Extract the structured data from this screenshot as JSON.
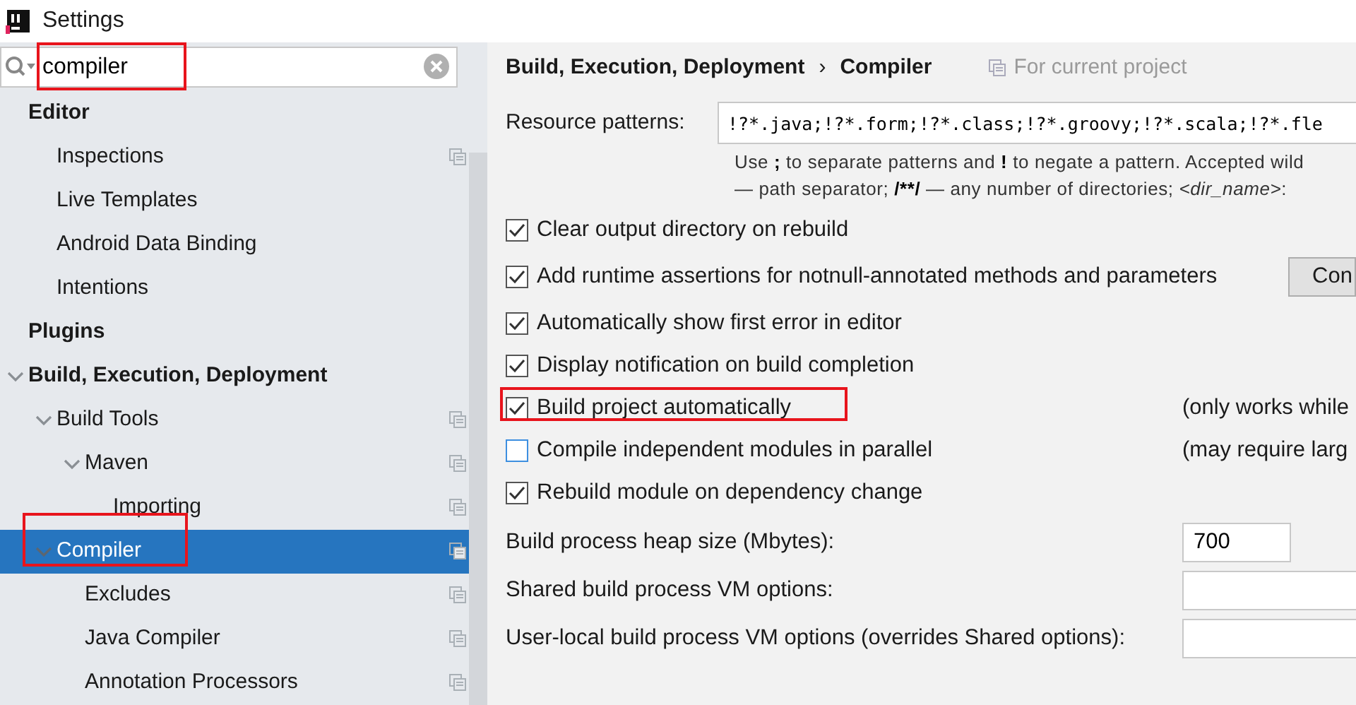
{
  "window": {
    "title": "Settings"
  },
  "search": {
    "value": "compiler",
    "annotated": true
  },
  "tree": [
    {
      "label": "Editor",
      "bold": true,
      "children": [
        {
          "label": "Inspections",
          "project_level": true
        },
        {
          "label": "Live Templates",
          "project_level": false
        },
        {
          "label": "Android Data Binding",
          "project_level": false
        },
        {
          "label": "Intentions",
          "project_level": false
        }
      ]
    },
    {
      "label": "Plugins",
      "bold": true
    },
    {
      "label": "Build, Execution, Deployment",
      "bold": true,
      "expanded": true,
      "children": [
        {
          "label": "Build Tools",
          "project_level": true,
          "expanded": true,
          "children": [
            {
              "label": "Maven",
              "project_level": true,
              "expanded": true,
              "children": [
                {
                  "label": "Importing",
                  "project_level": true
                }
              ]
            }
          ]
        },
        {
          "label": "Compiler",
          "project_level": true,
          "expanded": true,
          "selected": true,
          "annotated": true,
          "children": [
            {
              "label": "Excludes",
              "project_level": true
            },
            {
              "label": "Java Compiler",
              "project_level": true
            },
            {
              "label": "Annotation Processors",
              "project_level": true
            }
          ]
        }
      ]
    }
  ],
  "breadcrumb": {
    "parent": "Build, Execution, Deployment",
    "separator": "›",
    "current": "Compiler",
    "scope": "For current project"
  },
  "resource_patterns": {
    "label": "Resource patterns:",
    "value": "!?*.java;!?*.form;!?*.class;!?*.groovy;!?*.scala;!?*.fle",
    "hint": [
      [
        {
          "text": "Use "
        },
        {
          "text": ";",
          "bold": true
        },
        {
          "text": " to separate patterns and "
        },
        {
          "text": "!",
          "bold": true
        },
        {
          "text": " to negate a pattern. Accepted wild"
        }
      ],
      [
        {
          "text": "— path separator; "
        },
        {
          "text": "/**/",
          "bold": true
        },
        {
          "text": " — any number of directories; "
        },
        {
          "text": "<dir_name>",
          "italic": true
        },
        {
          "text": ":"
        }
      ]
    ]
  },
  "options": [
    {
      "label": "Clear output directory on rebuild",
      "checked": true,
      "annotated": false
    },
    {
      "label": "Add runtime assertions for notnull-annotated methods and parameters",
      "checked": true,
      "annotated": false,
      "button": "Con"
    },
    {
      "label": "Automatically show first error in editor",
      "checked": true,
      "annotated": false
    },
    {
      "label": "Display notification on build completion",
      "checked": true,
      "annotated": false
    },
    {
      "label": "Build project automatically",
      "checked": true,
      "annotated": true,
      "note": "(only works while"
    },
    {
      "label": "Compile independent modules in parallel",
      "checked": false,
      "annotated": false,
      "note": "(may require larg"
    },
    {
      "label": "Rebuild module on dependency change",
      "checked": true,
      "annotated": false
    }
  ],
  "fields": [
    {
      "label": "Build process heap size (Mbytes):",
      "value": "700",
      "kind": "short"
    },
    {
      "label": "Shared build process VM options:",
      "kind": "wide"
    },
    {
      "label": "User-local build process VM options (overrides Shared options):",
      "kind": "wide"
    }
  ]
}
